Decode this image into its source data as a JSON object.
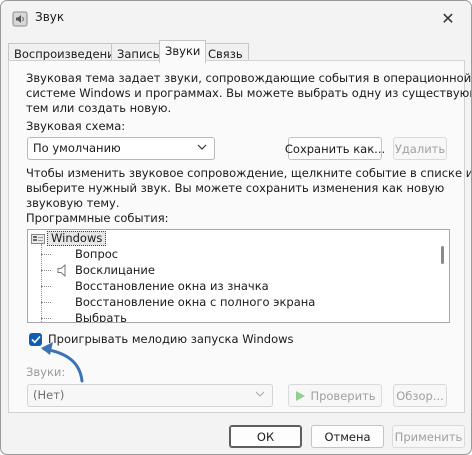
{
  "window": {
    "title": "Звук",
    "close_glyph": "✕"
  },
  "tabs": [
    {
      "label": "Воспроизведение"
    },
    {
      "label": "Запись"
    },
    {
      "label": "Звуки"
    },
    {
      "label": "Связь"
    }
  ],
  "active_tab": "Звуки",
  "panel": {
    "intro_line1": "Звуковая тема задает звуки, сопровождающие события в операционной",
    "intro_line2": "системе Windows и программах. Вы можете выбрать одну из существующих",
    "intro_line3": "тем или создать новую.",
    "scheme_label": "Звуковая схема:",
    "scheme_value": "По умолчанию",
    "save_as_label": "Сохранить как...",
    "delete_label": "Удалить",
    "hint_line1": "Чтобы изменить звуковое сопровождение, щелкните событие в списке и",
    "hint_line2": "выберите нужный звук. Вы можете сохранить изменения как новую",
    "hint_line3": "звуковую тему.",
    "events_label": "Программные события:",
    "events": [
      {
        "label": "Windows",
        "level": 0
      },
      {
        "label": "Вопрос",
        "level": 1
      },
      {
        "label": "Восклицание",
        "level": 1
      },
      {
        "label": "Восстановление окна из значка",
        "level": 1
      },
      {
        "label": "Восстановление окна с полного экрана",
        "level": 1
      },
      {
        "label": "Выбрать",
        "level": 1
      }
    ],
    "startup_checkbox_label": "Проигрывать мелодию запуска Windows",
    "startup_checked": true,
    "sounds_label": "Звуки:",
    "sound_value": "(Нет)",
    "test_label": "Проверить",
    "browse_label": "Обзор..."
  },
  "footer": {
    "ok_label": "ОК",
    "cancel_label": "Отмена",
    "apply_label": "Применить"
  },
  "colors": {
    "accent": "#0f5fb0",
    "annotation_arrow": "#3a73b4",
    "play_icon": "#4caf50"
  }
}
